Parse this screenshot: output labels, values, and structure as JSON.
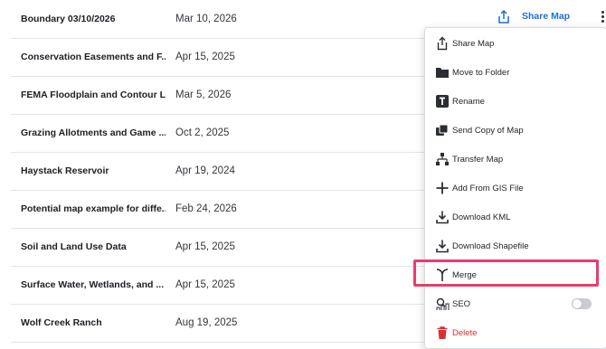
{
  "rows": [
    {
      "name": "Boundary 03/10/2026",
      "date": "Mar 10, 2026"
    },
    {
      "name": "Conservation Easements and F...",
      "date": "Apr 15, 2025"
    },
    {
      "name": "FEMA Floodplain and Contour L...",
      "date": "Mar 5, 2026"
    },
    {
      "name": "Grazing Allotments and Game ...",
      "date": "Oct 2, 2025"
    },
    {
      "name": "Haystack Reservoir",
      "date": "Apr 19, 2024"
    },
    {
      "name": "Potential map example for diffe...",
      "date": "Feb 24, 2026"
    },
    {
      "name": "Soil and Land Use Data",
      "date": "Apr 15, 2025"
    },
    {
      "name": "Surface Water, Wetlands, and ...",
      "date": "Apr 15, 2025"
    },
    {
      "name": "Wolf Creek Ranch",
      "date": "Aug 19, 2025"
    }
  ],
  "row_actions": {
    "share_label": "Share Map",
    "share_icon": "share-icon",
    "more_icon": "kebab-icon"
  },
  "menu": {
    "items": [
      {
        "label": "Share Map",
        "icon": "share-icon"
      },
      {
        "label": "Move to Folder",
        "icon": "folder-icon"
      },
      {
        "label": "Rename",
        "icon": "rename-icon"
      },
      {
        "label": "Send Copy of Map",
        "icon": "send-copy-icon"
      },
      {
        "label": "Transfer Map",
        "icon": "transfer-icon"
      },
      {
        "label": "Add From GIS File",
        "icon": "plus-icon"
      },
      {
        "label": "Download KML",
        "icon": "download-icon"
      },
      {
        "label": "Download Shapefile",
        "icon": "download-icon"
      },
      {
        "label": "Merge",
        "icon": "merge-icon"
      },
      {
        "label": "SEO",
        "icon": "seo-icon",
        "toggle": false
      },
      {
        "label": "Delete",
        "icon": "trash-icon"
      }
    ]
  },
  "colors": {
    "accent": "#1f6fd6",
    "danger": "#d93030",
    "highlight": "#ea3c6f"
  }
}
